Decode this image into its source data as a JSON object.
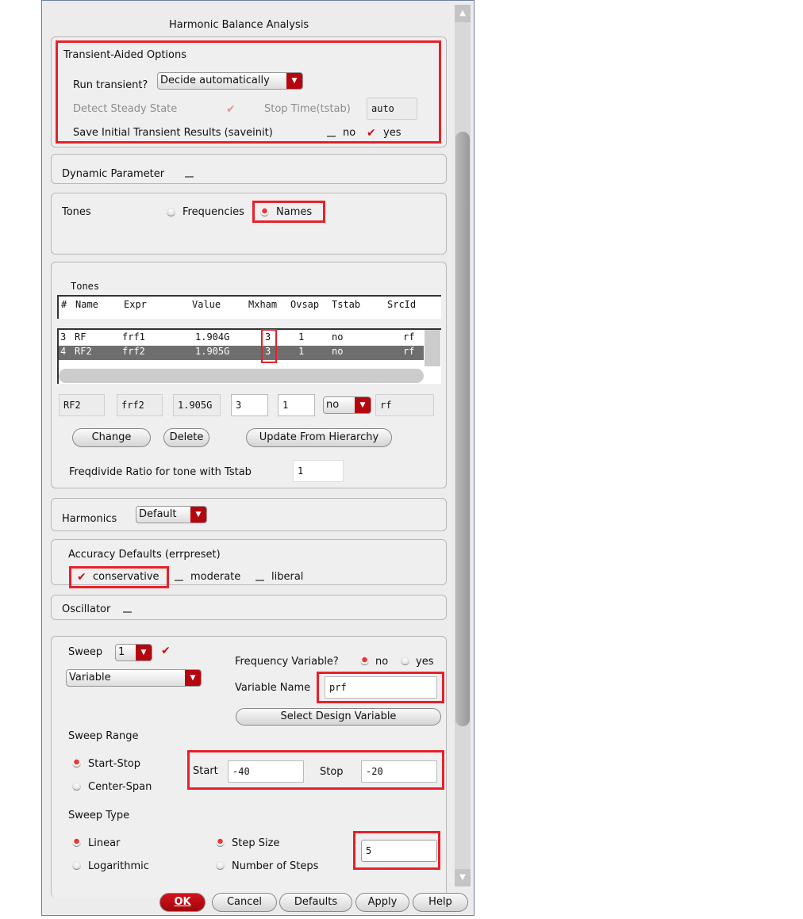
{
  "title": "Harmonic Balance Analysis",
  "transient": {
    "heading": "Transient-Aided Options",
    "run_label": "Run transient?",
    "run_value": "Decide automatically",
    "detect_label": "Detect Steady State",
    "detect_checked": true,
    "stop_label": "Stop Time(tstab)",
    "stop_value": "auto",
    "save_label": "Save Initial Transient Results (saveinit)",
    "no_label": "no",
    "yes_label": "yes"
  },
  "dynamic": {
    "label": "Dynamic Parameter"
  },
  "tones_mode": {
    "label": "Tones",
    "freq_label": "Frequencies",
    "names_label": "Names",
    "selected": "Names"
  },
  "tones_table": {
    "label": "Tones",
    "columns": [
      "#",
      "Name",
      "Expr",
      "Value",
      "Mxham",
      "Ovsap",
      "Tstab",
      "SrcId"
    ],
    "rows": [
      [
        "3",
        "RF",
        "frf1",
        "1.904G",
        "3",
        "1",
        "no",
        "rf"
      ],
      [
        "4",
        "RF2",
        "frf2",
        "1.905G",
        "3",
        "1",
        "no",
        "rf"
      ]
    ],
    "edit": {
      "name": "RF2",
      "expr": "frf2",
      "value": "1.905G",
      "mxham": "3",
      "ovsap": "1",
      "tstab": "no",
      "srcid": "rf"
    },
    "change": "Change",
    "delete": "Delete",
    "update": "Update From Hierarchy",
    "freqdiv_label": "Freqdivide Ratio for tone with Tstab",
    "freqdiv_value": "1"
  },
  "harmonics": {
    "label": "Harmonics",
    "value": "Default"
  },
  "accuracy": {
    "label": "Accuracy Defaults (errpreset)",
    "options": [
      "conservative",
      "moderate",
      "liberal"
    ],
    "selected": "conservative"
  },
  "oscillator": {
    "label": "Oscillator"
  },
  "sweep": {
    "label": "Sweep",
    "count": "1",
    "type": "Variable",
    "freqvar_label": "Frequency Variable?",
    "no": "no",
    "yes": "yes",
    "varname_label": "Variable Name",
    "varname": "prf",
    "select_btn": "Select Design Variable",
    "range_label": "Sweep Range",
    "start_stop": "Start-Stop",
    "center_span": "Center-Span",
    "start_label": "Start",
    "start": "-40",
    "stop_label": "Stop",
    "stop": "-20",
    "type_label": "Sweep Type",
    "linear": "Linear",
    "log": "Logarithmic",
    "step_size": "Step Size",
    "num_steps": "Number of Steps",
    "step_value": "5"
  },
  "buttons": {
    "ok": "OK",
    "cancel": "Cancel",
    "defaults": "Defaults",
    "apply": "Apply",
    "help": "Help"
  }
}
